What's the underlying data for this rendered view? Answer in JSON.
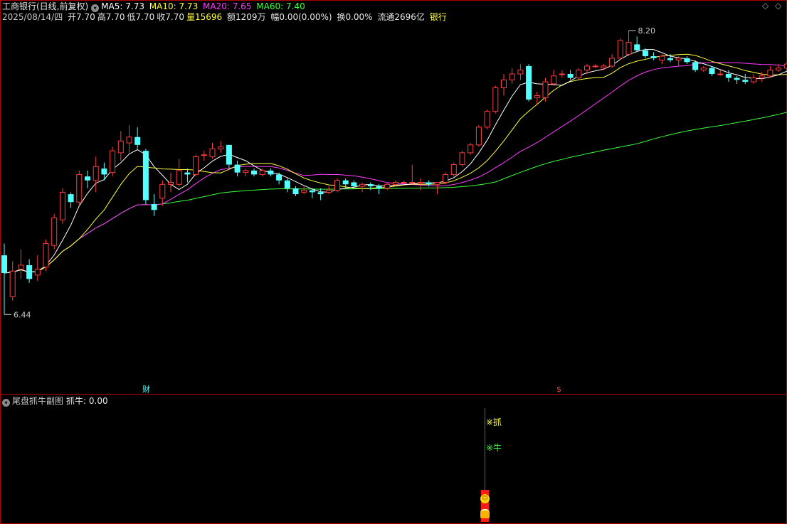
{
  "header": {
    "title": "工商银行(日线,前复权)",
    "ma5": "MA5: 7.73",
    "ma10": "MA10: 7.73",
    "ma20": "MA20: 7.65",
    "ma60": "MA60: 7.40",
    "date": "2025/08/14/四",
    "open": "开7.70",
    "high": "高7.70",
    "low": "低7.70",
    "close": "收7.70",
    "volume_label": "量",
    "volume_value": "15696",
    "amount": "额1209万",
    "change": "幅0.00(0.00%)",
    "turnover": "换0.00%",
    "float": "流通2696亿",
    "sector": "银行"
  },
  "markers": {
    "high_label": "8.20",
    "low_label": "6.44",
    "finance_badge": "财",
    "dollar_badge": "$"
  },
  "subchart": {
    "title": "尾盘抓牛副图",
    "value": "抓牛: 0.00",
    "signal_1": "※抓",
    "signal_2": "※牛"
  },
  "colors": {
    "up": "#ff3b3b",
    "down": "#54ffff",
    "ma5": "#ffffff",
    "ma10": "#ffff3b",
    "ma20": "#ff3bff",
    "ma60": "#3bff3b",
    "border": "#b00000"
  },
  "chart_data": {
    "type": "candlestick",
    "ylim": [
      6.44,
      8.2
    ],
    "candles": [
      {
        "o": 7.06,
        "h": 7.12,
        "l": 6.76,
        "c": 6.97
      },
      {
        "o": 6.85,
        "h": 7.03,
        "l": 6.83,
        "c": 6.98
      },
      {
        "o": 6.99,
        "h": 7.09,
        "l": 6.94,
        "c": 7.01
      },
      {
        "o": 7.01,
        "h": 7.04,
        "l": 6.92,
        "c": 6.94
      },
      {
        "o": 6.96,
        "h": 7.06,
        "l": 6.93,
        "c": 6.99
      },
      {
        "o": 7.0,
        "h": 7.14,
        "l": 6.98,
        "c": 7.12
      },
      {
        "o": 7.11,
        "h": 7.27,
        "l": 7.09,
        "c": 7.25
      },
      {
        "o": 7.24,
        "h": 7.4,
        "l": 7.22,
        "c": 7.38
      },
      {
        "o": 7.37,
        "h": 7.38,
        "l": 7.3,
        "c": 7.33
      },
      {
        "o": 7.33,
        "h": 7.49,
        "l": 7.31,
        "c": 7.47
      },
      {
        "o": 7.46,
        "h": 7.49,
        "l": 7.4,
        "c": 7.44
      },
      {
        "o": 7.44,
        "h": 7.56,
        "l": 7.38,
        "c": 7.51
      },
      {
        "o": 7.5,
        "h": 7.53,
        "l": 7.44,
        "c": 7.47
      },
      {
        "o": 7.48,
        "h": 7.61,
        "l": 7.46,
        "c": 7.59
      },
      {
        "o": 7.58,
        "h": 7.69,
        "l": 7.54,
        "c": 7.64
      },
      {
        "o": 7.63,
        "h": 7.72,
        "l": 7.58,
        "c": 7.66
      },
      {
        "o": 7.66,
        "h": 7.71,
        "l": 7.6,
        "c": 7.62
      },
      {
        "o": 7.59,
        "h": 7.6,
        "l": 7.32,
        "c": 7.34
      },
      {
        "o": 7.32,
        "h": 7.37,
        "l": 7.26,
        "c": 7.29
      },
      {
        "o": 7.35,
        "h": 7.44,
        "l": 7.31,
        "c": 7.42
      },
      {
        "o": 7.42,
        "h": 7.48,
        "l": 7.38,
        "c": 7.43
      },
      {
        "o": 7.42,
        "h": 7.55,
        "l": 7.41,
        "c": 7.49
      },
      {
        "o": 7.48,
        "h": 7.5,
        "l": 7.43,
        "c": 7.47
      },
      {
        "o": 7.47,
        "h": 7.57,
        "l": 7.46,
        "c": 7.56
      },
      {
        "o": 7.57,
        "h": 7.59,
        "l": 7.54,
        "c": 7.57
      },
      {
        "o": 7.56,
        "h": 7.63,
        "l": 7.55,
        "c": 7.6
      },
      {
        "o": 7.6,
        "h": 7.64,
        "l": 7.58,
        "c": 7.61
      },
      {
        "o": 7.62,
        "h": 7.62,
        "l": 7.5,
        "c": 7.52
      },
      {
        "o": 7.52,
        "h": 7.54,
        "l": 7.46,
        "c": 7.48
      },
      {
        "o": 7.48,
        "h": 7.5,
        "l": 7.46,
        "c": 7.49
      },
      {
        "o": 7.49,
        "h": 7.5,
        "l": 7.46,
        "c": 7.47
      },
      {
        "o": 7.47,
        "h": 7.5,
        "l": 7.46,
        "c": 7.49
      },
      {
        "o": 7.49,
        "h": 7.5,
        "l": 7.46,
        "c": 7.47
      },
      {
        "o": 7.47,
        "h": 7.48,
        "l": 7.42,
        "c": 7.44
      },
      {
        "o": 7.44,
        "h": 7.45,
        "l": 7.38,
        "c": 7.4
      },
      {
        "o": 7.4,
        "h": 7.41,
        "l": 7.36,
        "c": 7.37
      },
      {
        "o": 7.38,
        "h": 7.41,
        "l": 7.37,
        "c": 7.39
      },
      {
        "o": 7.39,
        "h": 7.4,
        "l": 7.35,
        "c": 7.38
      },
      {
        "o": 7.38,
        "h": 7.4,
        "l": 7.34,
        "c": 7.37
      },
      {
        "o": 7.38,
        "h": 7.41,
        "l": 7.37,
        "c": 7.39
      },
      {
        "o": 7.39,
        "h": 7.45,
        "l": 7.38,
        "c": 7.44
      },
      {
        "o": 7.44,
        "h": 7.45,
        "l": 7.4,
        "c": 7.42
      },
      {
        "o": 7.43,
        "h": 7.44,
        "l": 7.4,
        "c": 7.41
      },
      {
        "o": 7.41,
        "h": 7.43,
        "l": 7.38,
        "c": 7.42
      },
      {
        "o": 7.42,
        "h": 7.43,
        "l": 7.39,
        "c": 7.41
      },
      {
        "o": 7.41,
        "h": 7.42,
        "l": 7.37,
        "c": 7.4
      },
      {
        "o": 7.4,
        "h": 7.43,
        "l": 7.39,
        "c": 7.42
      },
      {
        "o": 7.42,
        "h": 7.44,
        "l": 7.41,
        "c": 7.43
      },
      {
        "o": 7.43,
        "h": 7.44,
        "l": 7.42,
        "c": 7.43
      },
      {
        "o": 7.43,
        "h": 7.52,
        "l": 7.42,
        "c": 7.43
      },
      {
        "o": 7.43,
        "h": 7.45,
        "l": 7.39,
        "c": 7.43
      },
      {
        "o": 7.43,
        "h": 7.44,
        "l": 7.41,
        "c": 7.42
      },
      {
        "o": 7.42,
        "h": 7.43,
        "l": 7.37,
        "c": 7.43
      },
      {
        "o": 7.43,
        "h": 7.48,
        "l": 7.42,
        "c": 7.47
      },
      {
        "o": 7.47,
        "h": 7.53,
        "l": 7.46,
        "c": 7.52
      },
      {
        "o": 7.52,
        "h": 7.59,
        "l": 7.51,
        "c": 7.58
      },
      {
        "o": 7.58,
        "h": 7.63,
        "l": 7.57,
        "c": 7.62
      },
      {
        "o": 7.62,
        "h": 7.72,
        "l": 7.61,
        "c": 7.71
      },
      {
        "o": 7.71,
        "h": 7.8,
        "l": 7.7,
        "c": 7.79
      },
      {
        "o": 7.79,
        "h": 7.92,
        "l": 7.78,
        "c": 7.91
      },
      {
        "o": 7.91,
        "h": 7.98,
        "l": 7.87,
        "c": 7.95
      },
      {
        "o": 7.95,
        "h": 8.01,
        "l": 7.93,
        "c": 7.98
      },
      {
        "o": 7.98,
        "h": 8.03,
        "l": 7.95,
        "c": 8.0
      },
      {
        "o": 8.02,
        "h": 8.03,
        "l": 7.84,
        "c": 7.85
      },
      {
        "o": 7.86,
        "h": 7.89,
        "l": 7.82,
        "c": 7.87
      },
      {
        "o": 7.86,
        "h": 7.96,
        "l": 7.84,
        "c": 7.94
      },
      {
        "o": 7.93,
        "h": 8.0,
        "l": 7.92,
        "c": 7.97
      },
      {
        "o": 7.98,
        "h": 8.0,
        "l": 7.96,
        "c": 7.98
      },
      {
        "o": 7.98,
        "h": 8.0,
        "l": 7.95,
        "c": 7.96
      },
      {
        "o": 7.96,
        "h": 8.01,
        "l": 7.95,
        "c": 8.0
      },
      {
        "o": 8.0,
        "h": 8.03,
        "l": 7.98,
        "c": 8.02
      },
      {
        "o": 8.02,
        "h": 8.03,
        "l": 8.01,
        "c": 8.02
      },
      {
        "o": 8.01,
        "h": 8.03,
        "l": 8.0,
        "c": 8.02
      },
      {
        "o": 8.02,
        "h": 8.08,
        "l": 8.01,
        "c": 8.06
      },
      {
        "o": 8.06,
        "h": 8.16,
        "l": 8.05,
        "c": 8.15
      },
      {
        "o": 8.08,
        "h": 8.2,
        "l": 8.07,
        "c": 8.14
      },
      {
        "o": 8.13,
        "h": 8.17,
        "l": 8.09,
        "c": 8.1
      },
      {
        "o": 8.1,
        "h": 8.11,
        "l": 8.06,
        "c": 8.07
      },
      {
        "o": 8.07,
        "h": 8.09,
        "l": 8.05,
        "c": 8.06
      },
      {
        "o": 8.05,
        "h": 8.08,
        "l": 8.03,
        "c": 8.07
      },
      {
        "o": 8.06,
        "h": 8.08,
        "l": 8.04,
        "c": 8.05
      },
      {
        "o": 8.05,
        "h": 8.07,
        "l": 8.02,
        "c": 8.06
      },
      {
        "o": 8.06,
        "h": 8.07,
        "l": 8.03,
        "c": 8.04
      },
      {
        "o": 8.04,
        "h": 8.05,
        "l": 7.99,
        "c": 8.0
      },
      {
        "o": 8.0,
        "h": 8.02,
        "l": 7.99,
        "c": 8.01
      },
      {
        "o": 8.01,
        "h": 8.02,
        "l": 7.97,
        "c": 7.98
      },
      {
        "o": 7.98,
        "h": 8.0,
        "l": 7.97,
        "c": 7.98
      },
      {
        "o": 7.98,
        "h": 8.0,
        "l": 7.94,
        "c": 7.96
      },
      {
        "o": 7.96,
        "h": 7.97,
        "l": 7.93,
        "c": 7.95
      },
      {
        "o": 7.95,
        "h": 7.98,
        "l": 7.93,
        "c": 7.94
      },
      {
        "o": 7.94,
        "h": 7.98,
        "l": 7.93,
        "c": 7.96
      },
      {
        "o": 7.96,
        "h": 7.99,
        "l": 7.94,
        "c": 7.97
      },
      {
        "o": 7.97,
        "h": 8.02,
        "l": 7.96,
        "c": 8.0
      },
      {
        "o": 8.0,
        "h": 8.03,
        "l": 7.99,
        "c": 8.01
      },
      {
        "o": 8.01,
        "h": 8.04,
        "l": 8.0,
        "c": 8.03
      },
      {
        "o": 8.03,
        "h": 8.06,
        "l": 8.02,
        "c": 8.05
      },
      {
        "o": 8.06,
        "h": 8.09,
        "l": 8.05,
        "c": 8.07
      },
      {
        "o": 8.07,
        "h": 8.1,
        "l": 8.06,
        "c": 8.08
      },
      {
        "o": 8.08,
        "h": 8.09,
        "l": 8.04,
        "c": 8.05
      },
      {
        "o": 8.05,
        "h": 8.06,
        "l": 8.02,
        "c": 8.03
      },
      {
        "o": 8.04,
        "h": 8.07,
        "l": 8.02,
        "c": 8.06
      },
      {
        "o": 8.06,
        "h": 8.08,
        "l": 8.03,
        "c": 8.04
      },
      {
        "o": 8.04,
        "h": 8.06,
        "l": 8.03,
        "c": 8.04
      }
    ]
  }
}
